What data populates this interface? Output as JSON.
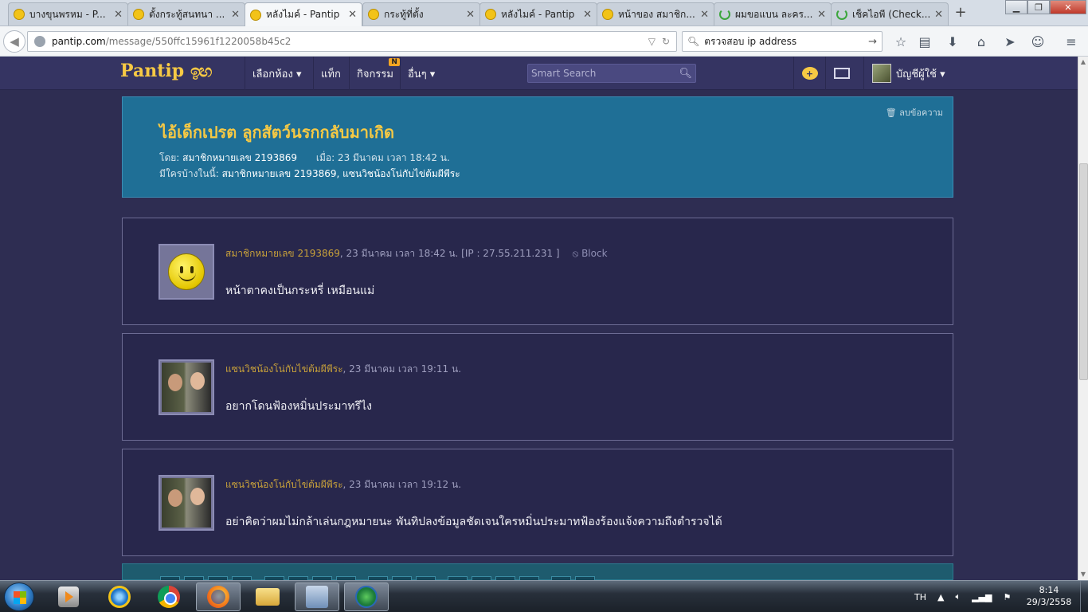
{
  "browser": {
    "tabs": [
      {
        "label": "บางขุนพรหม - P...",
        "icon": "pantip-icon",
        "active": false
      },
      {
        "label": "ตั้งกระทู้สนทนา ...",
        "icon": "pantip-icon",
        "active": false
      },
      {
        "label": "หลังไมค์ - Pantip",
        "icon": "pantip-icon",
        "active": true
      },
      {
        "label": "กระทู้ที่ตั้ง",
        "icon": "pantip-icon",
        "active": false
      },
      {
        "label": "หลังไมค์ - Pantip",
        "icon": "pantip-icon",
        "active": false
      },
      {
        "label": "หน้าของ สมาชิก...",
        "icon": "pantip-icon",
        "active": false
      },
      {
        "label": "ผมขอแบน ละคร...",
        "icon": "loading-icon",
        "active": false
      },
      {
        "label": "เช็คไอพี (Check...",
        "icon": "loading-icon",
        "active": false
      }
    ],
    "url_host": "pantip.com",
    "url_path": "/message/550ffc15961f1220058b45c2",
    "search_query": "ตรวจสอบ ip address"
  },
  "site": {
    "logo_text": "Pantip",
    "logo_mark": "ඉඟ",
    "menu": [
      {
        "label": "เลือกห้อง ▾"
      },
      {
        "label": "แท็ก"
      },
      {
        "label": "กิจกรรม",
        "badge": "N"
      },
      {
        "label": "อื่นๆ ▾"
      }
    ],
    "search_placeholder": "Smart Search",
    "account_label": "บัญชีผู้ใช้ ▾"
  },
  "topic": {
    "delete_label": "🗑 ลบข้อความ",
    "title": "ไอ้เด็กเปรต ลูกสัตว์นรกกลับมาเกิด",
    "by_label": "โดย: ",
    "author": "สมาชิกหมายเลข 2193869",
    "when_label": "เมื่อ: 23 มีนาคม เวลา 18:42 น.",
    "participants_label": "มีใครบ้างในนี้: ",
    "participants": "สมาชิกหมายเลข 2193869, แซนวิชน้องโน่กับไข่ต้มผีพีระ"
  },
  "messages": [
    {
      "avatar": "smiley",
      "user": "สมาชิกหมายเลข 2193869",
      "meta": ", 23 มีนาคม เวลา 18:42 น. [IP : 27.55.211.231 ]",
      "block": "⦸ Block",
      "text": "หน้าตาคงเป็นกระหรี่ เหมือนแม่"
    },
    {
      "avatar": "photo",
      "user": "แซนวิชน้องโน่กับไข่ต้มผีพีระ",
      "meta": ", 23 มีนาคม เวลา 19:11 น.",
      "block": "",
      "text": "อยากโดนฟ้องหมิ่นประมาทรึไง"
    },
    {
      "avatar": "photo",
      "user": "แซนวิชน้องโน่กับไข่ต้มผีพีระ",
      "meta": ", 23 มีนาคม เวลา 19:12 น.",
      "block": "",
      "text": "อย่าคิดว่าผมไม่กล้าเล่นกฎหมายนะ พันทิปลงข้อมูลชัดเจนใครหมิ่นประมาทฟ้องร้องแจ้งความถึงตำรวจได้"
    }
  ],
  "taskbar": {
    "lang": "TH",
    "time": "8:14",
    "date": "29/3/2558"
  },
  "colors": {
    "page_bg": "#2e2d52",
    "topic_bg": "#1f6f96",
    "title_gold": "#f6c944",
    "username_gold": "#c8a13a"
  }
}
